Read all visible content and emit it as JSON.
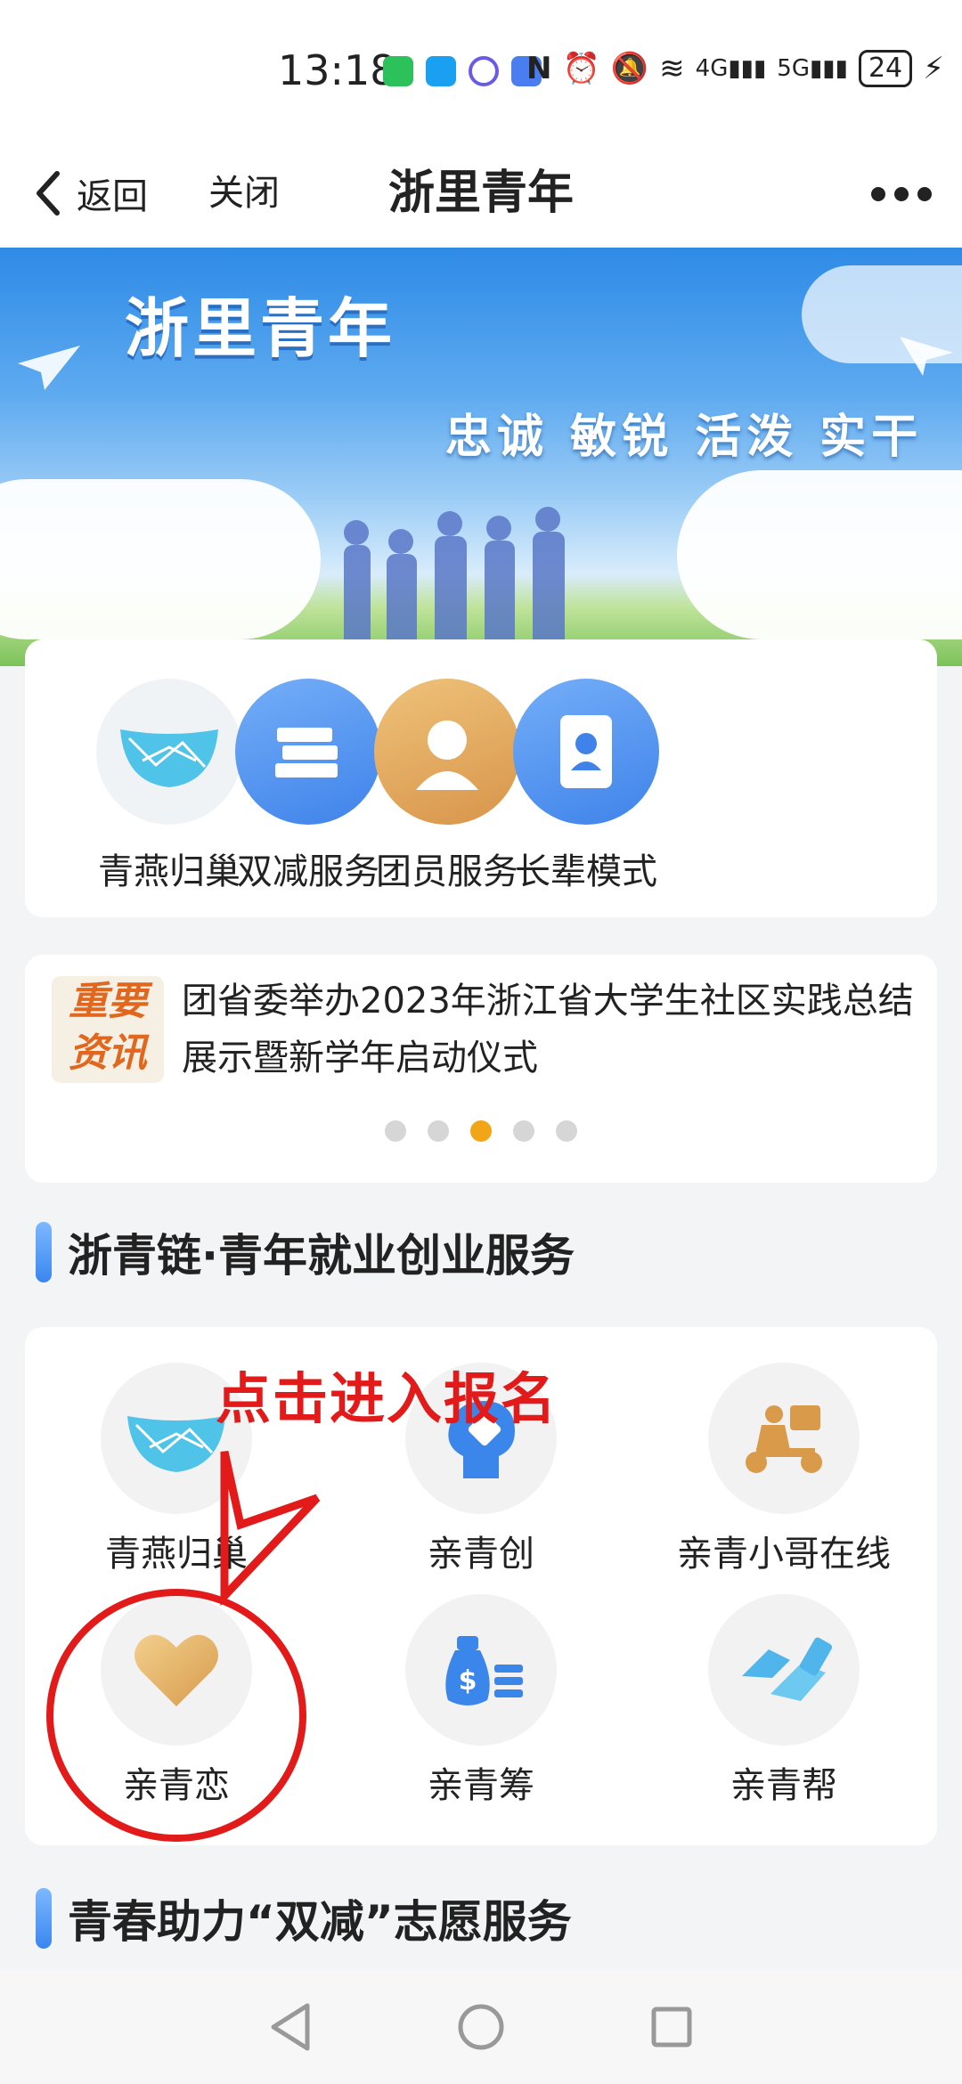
{
  "status_bar": {
    "time": "13:18",
    "battery": "24",
    "net1": "4G",
    "net2": "5G"
  },
  "nav": {
    "back_label": "返回",
    "close_label": "关闭",
    "title": "浙里青年"
  },
  "banner": {
    "title": "浙里青年",
    "slogan": "忠诚 敏锐 活泼 实干"
  },
  "services": [
    {
      "label": "青燕归巢",
      "icon": "nest-icon"
    },
    {
      "label": "双减服务",
      "icon": "books-icon"
    },
    {
      "label": "团员服务",
      "icon": "member-icon"
    },
    {
      "label": "长辈模式",
      "icon": "elder-mode-icon"
    }
  ],
  "news": {
    "badge_line1": "重要",
    "badge_line2": "资讯",
    "text": "团省委举办2023年浙江省大学生社区实践总结展示暨新学年启动仪式",
    "pages": 5,
    "active_page": 3
  },
  "section1": {
    "title": "浙青链·青年就业创业服务"
  },
  "jobs": [
    {
      "label": "青燕归巢",
      "icon": "nest-icon"
    },
    {
      "label": "亲青创",
      "icon": "puzzle-head-icon"
    },
    {
      "label": "亲青小哥在线",
      "icon": "delivery-scooter-icon"
    },
    {
      "label": "亲青恋",
      "icon": "heart-icon"
    },
    {
      "label": "亲青筹",
      "icon": "money-bag-icon"
    },
    {
      "label": "亲青帮",
      "icon": "handshake-icon"
    }
  ],
  "annotation": {
    "text": "点击进入报名"
  },
  "section2": {
    "title": "青春助力“双减”志愿服务"
  },
  "colors": {
    "accent_blue": "#3a86f0",
    "annotation_red": "#e21a1a",
    "gold": "#e6b467",
    "pager_active": "#f2a516"
  }
}
